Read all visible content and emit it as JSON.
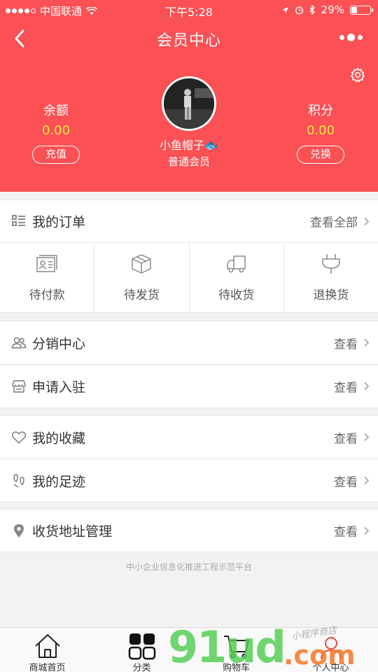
{
  "status_bar": {
    "carrier": "中国联通",
    "time": "下午5:28",
    "battery": "29%"
  },
  "header": {
    "title": "会员中心"
  },
  "profile": {
    "balance_label": "余额",
    "balance_value": "0.00",
    "recharge_label": "充值",
    "points_label": "积分",
    "points_value": "0.00",
    "exchange_label": "兑换",
    "username": "小鱼帽子🐟",
    "level": "普通会员"
  },
  "orders": {
    "title": "我的订单",
    "view_all": "查看全部",
    "items": [
      {
        "label": "待付款",
        "icon": "card-icon"
      },
      {
        "label": "待发货",
        "icon": "box-icon"
      },
      {
        "label": "待收货",
        "icon": "truck-icon"
      },
      {
        "label": "退换货",
        "icon": "plug-icon"
      }
    ]
  },
  "menu": [
    {
      "label": "分销中心",
      "action": "查看",
      "icon": "users-icon"
    },
    {
      "label": "申请入驻",
      "action": "查看",
      "icon": "shop-icon"
    },
    {
      "label": "我的收藏",
      "action": "查看",
      "icon": "heart-icon"
    },
    {
      "label": "我的足迹",
      "action": "查看",
      "icon": "footprint-icon"
    },
    {
      "label": "收货地址管理",
      "action": "查看",
      "icon": "location-icon"
    }
  ],
  "footer": {
    "text": "中小企业信息化推进工程示范平台"
  },
  "tabbar": [
    {
      "label": "商城首页",
      "icon": "home-icon"
    },
    {
      "label": "分类",
      "icon": "grid-icon"
    },
    {
      "label": "购物车",
      "icon": "cart-icon"
    },
    {
      "label": "个人中心",
      "icon": "person-icon"
    }
  ],
  "watermark": {
    "big": "91ud",
    "com": ".com",
    "small": "小程序商店"
  },
  "colors": {
    "primary": "#fb5054",
    "value_yellow": "#ffe84a"
  }
}
